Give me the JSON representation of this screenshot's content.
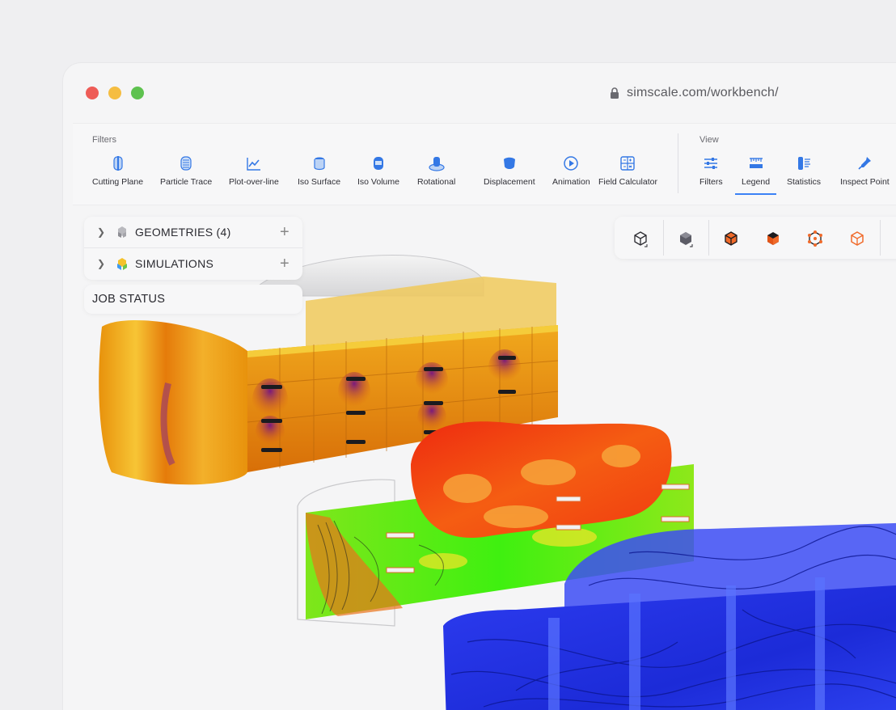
{
  "window": {
    "url": "simscale.com/workbench/",
    "traffic_lights": {
      "close": "#ee5c57",
      "minimize": "#f5bd41",
      "maximize": "#5ec24f"
    }
  },
  "toolbar": {
    "filters_label": "Filters",
    "view_label": "View",
    "filters": [
      {
        "label": "Cutting Plane",
        "icon": "cutting-plane-icon"
      },
      {
        "label": "Particle Trace",
        "icon": "particle-trace-icon"
      },
      {
        "label": "Plot-over-line",
        "icon": "plot-over-line-icon"
      },
      {
        "label": "Iso Surface",
        "icon": "iso-surface-icon"
      },
      {
        "label": "Iso Volume",
        "icon": "iso-volume-icon"
      },
      {
        "label": "Rotational",
        "icon": "rotational-icon"
      },
      {
        "label": "Displacement",
        "icon": "displacement-icon"
      },
      {
        "label": "Animation",
        "icon": "animation-icon"
      },
      {
        "label": "Field Calculator",
        "icon": "field-calculator-icon"
      }
    ],
    "view": [
      {
        "label": "Filters",
        "icon": "filters-sliders-icon"
      },
      {
        "label": "Legend",
        "icon": "legend-icon",
        "active": true
      },
      {
        "label": "Statistics",
        "icon": "statistics-icon"
      },
      {
        "label": "Inspect Point",
        "icon": "inspect-point-icon"
      }
    ],
    "accent": "#3b82f6"
  },
  "tree": {
    "geometries": "GEOMETRIES (4)",
    "simulations": "SIMULATIONS"
  },
  "job_status": "JOB STATUS",
  "viewbar": {
    "icons": [
      "cube-outline-icon",
      "cube-solid-icon",
      "cube-orange-icon",
      "cube-black-orange-icon",
      "cube-points-icon",
      "cube-orange-outline-icon"
    ]
  }
}
